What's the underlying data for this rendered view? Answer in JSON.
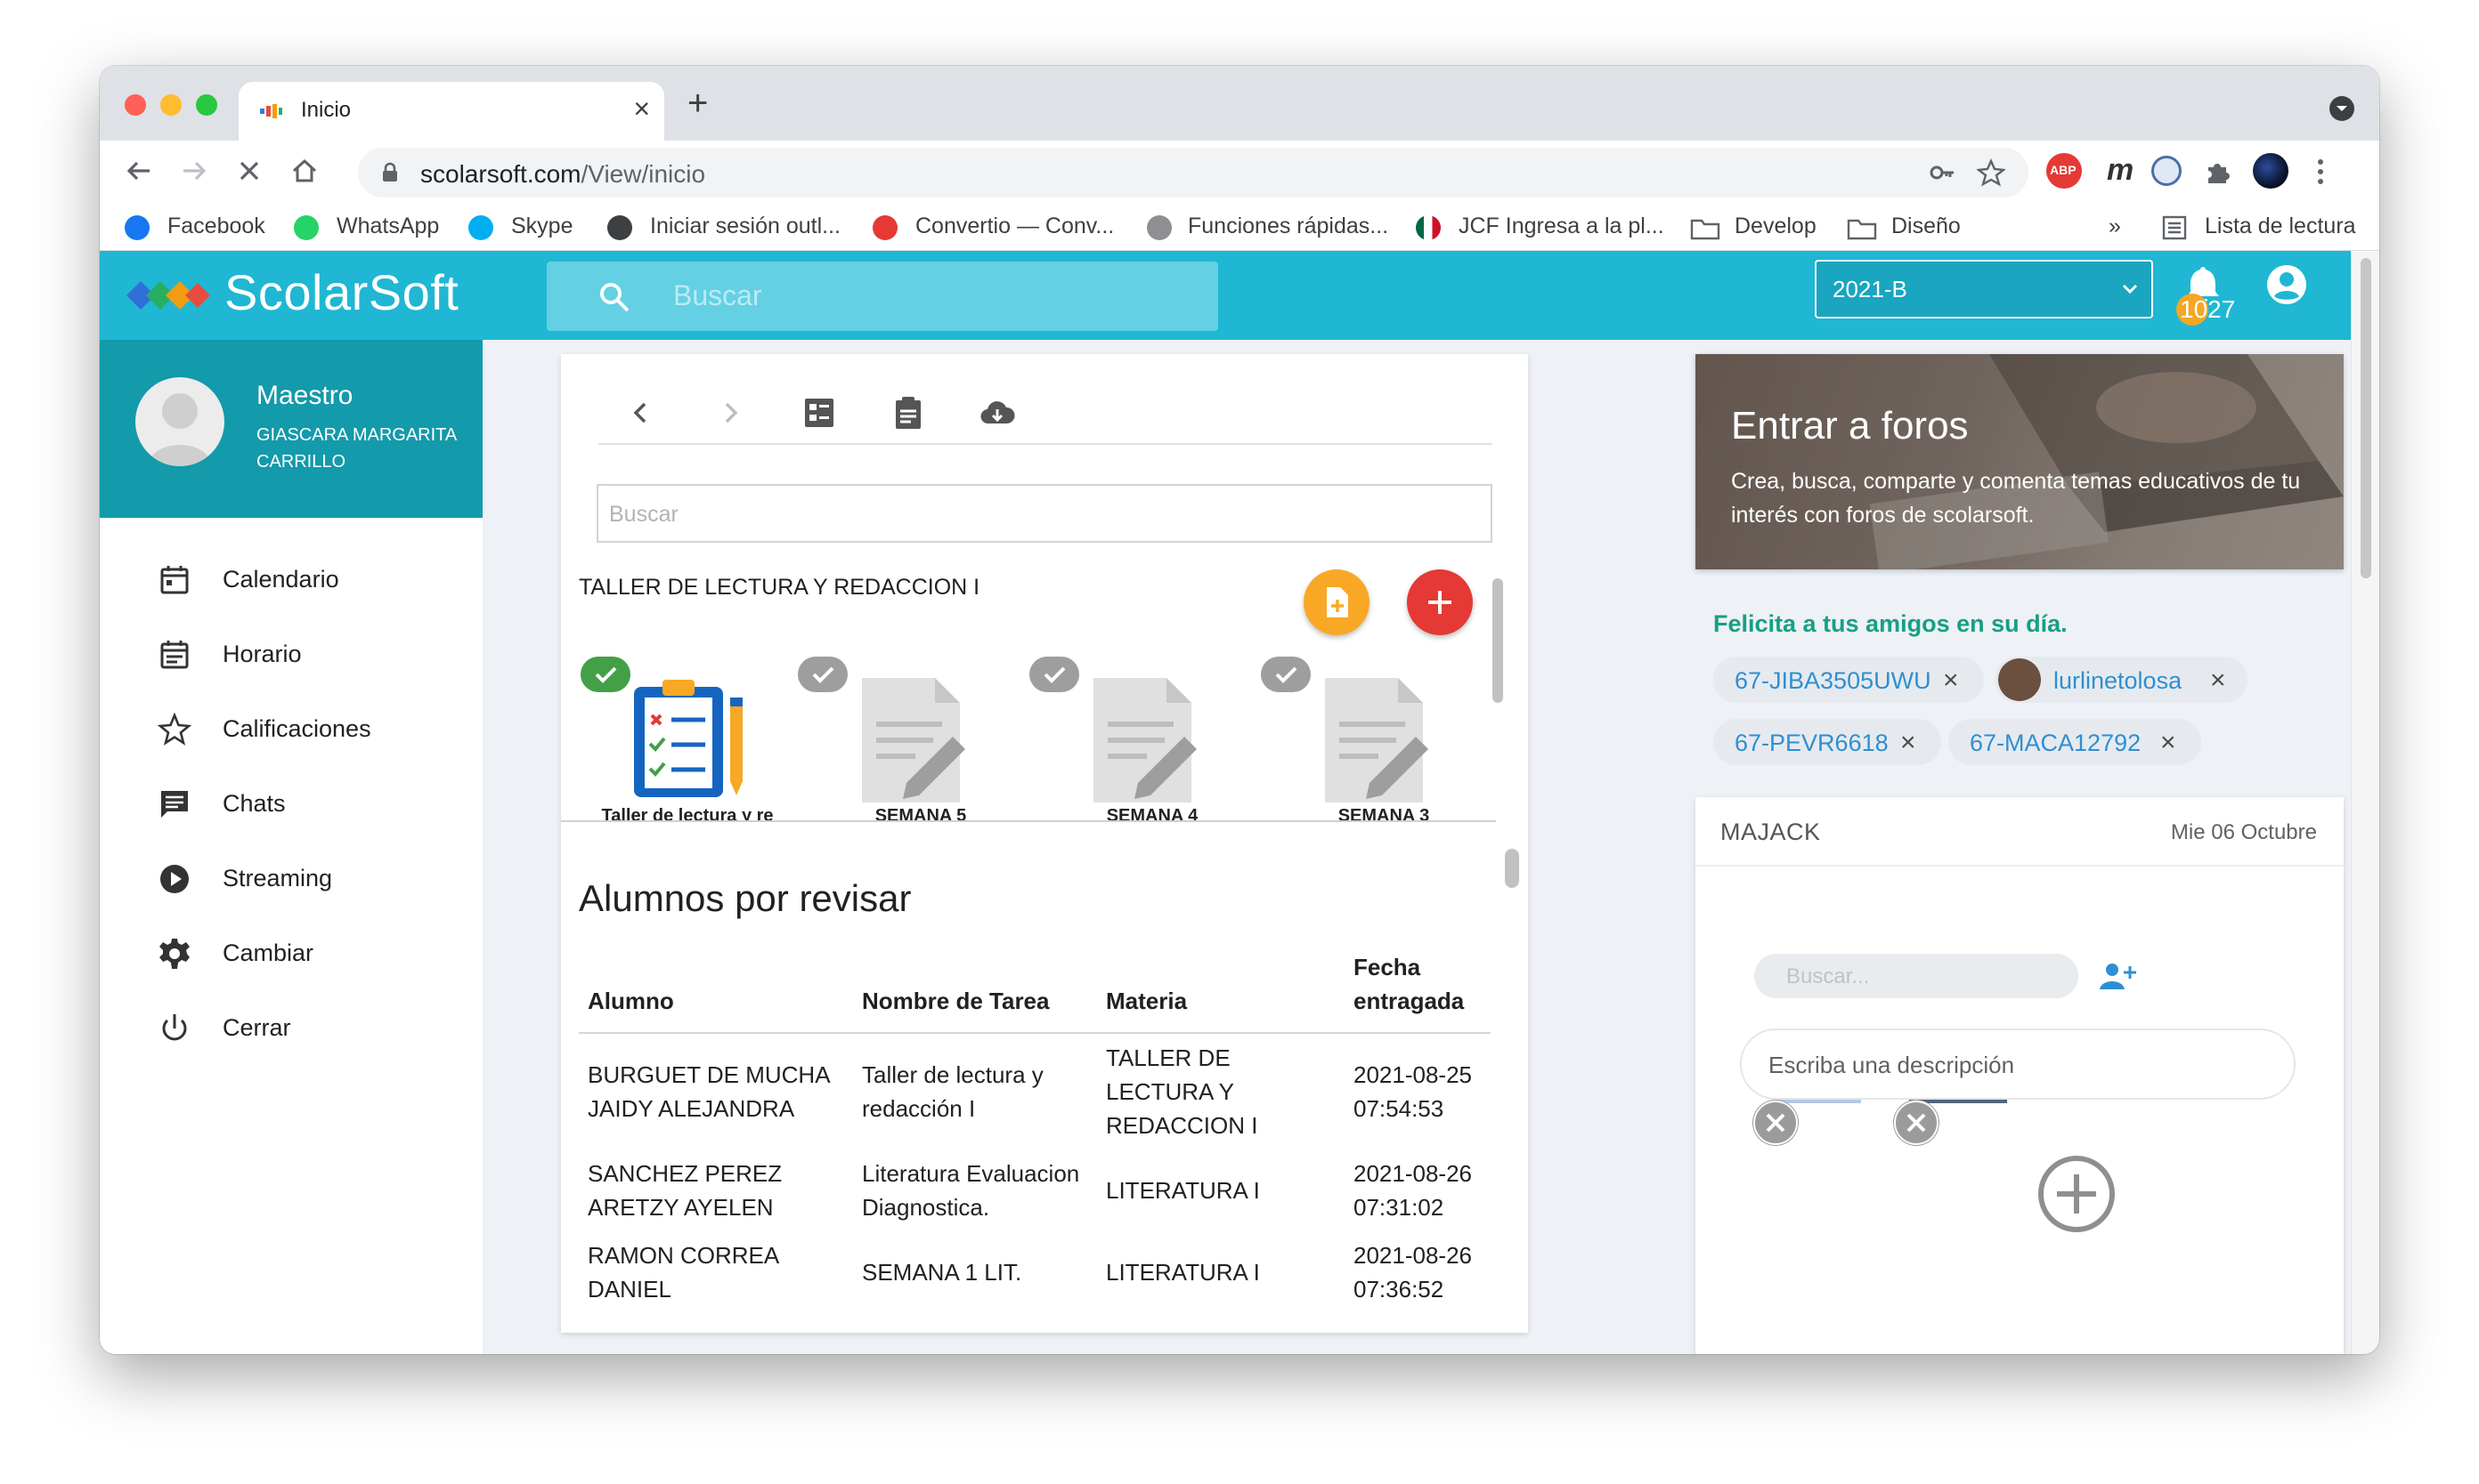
{
  "browser": {
    "tab_title": "Inicio",
    "url_host": "scolarsoft.com",
    "url_path": "/View/inicio",
    "ext_abp": "ABP",
    "ext_m": "m",
    "bookmarks": [
      {
        "label": "Facebook"
      },
      {
        "label": "WhatsApp"
      },
      {
        "label": "Skype"
      },
      {
        "label": "Iniciar sesión outl..."
      },
      {
        "label": "Convertio — Conv..."
      },
      {
        "label": "Funciones rápidas..."
      },
      {
        "label": "JCF Ingresa a la pl..."
      },
      {
        "label": "Develop"
      },
      {
        "label": "Diseño"
      }
    ],
    "overflow": "»",
    "reading_list": "Lista de lectura"
  },
  "header": {
    "logo": "ScolarSoft",
    "search_placeholder": "Buscar",
    "period": "2021-B",
    "notifications": "1027",
    "colors": {
      "primary": "#1fb7d3",
      "sidebar_profile": "#139aab"
    }
  },
  "sidebar": {
    "role": "Maestro",
    "name": "GIASCARA MARGARITA CARRILLO",
    "items": [
      {
        "label": "Calendario",
        "icon": "calendar-icon"
      },
      {
        "label": "Horario",
        "icon": "schedule-icon"
      },
      {
        "label": "Calificaciones",
        "icon": "star-icon"
      },
      {
        "label": "Chats",
        "icon": "chat-icon"
      },
      {
        "label": "Streaming",
        "icon": "play-icon"
      },
      {
        "label": "Cambiar",
        "icon": "gear-icon"
      },
      {
        "label": "Cerrar",
        "icon": "power-icon"
      }
    ]
  },
  "main": {
    "search_placeholder": "Buscar",
    "course": "TALLER DE LECTURA Y REDACCION I",
    "assignments": [
      {
        "label": "Taller de lectura y re"
      },
      {
        "label": "SEMANA 5"
      },
      {
        "label": "SEMANA 4"
      },
      {
        "label": "SEMANA 3"
      }
    ],
    "review_title": "Alumnos por revisar",
    "table": {
      "headers": [
        "Alumno",
        "Nombre de Tarea",
        "Materia",
        "Fecha entragada"
      ],
      "rows": [
        [
          "BURGUET DE MUCHA JAIDY ALEJANDRA",
          "Taller de lectura y redacción I",
          "TALLER DE LECTURA Y REDACCION I",
          "2021-08-25 07:54:53"
        ],
        [
          "SANCHEZ PEREZ ARETZY AYELEN",
          "Literatura Evaluacion Diagnostica.",
          "LITERATURA I",
          "2021-08-26 07:31:02"
        ],
        [
          "RAMON CORREA DANIEL",
          "SEMANA 1 LIT.",
          "LITERATURA I",
          "2021-08-26 07:36:52"
        ]
      ]
    }
  },
  "right": {
    "forum_title": "Entrar a foros",
    "forum_desc": "Crea, busca, comparte y comenta temas educativos de tu interés con foros de scolarsoft.",
    "congrats": "Felicita a tus amigos en su día.",
    "chips": [
      "67-JIBA3505UWU",
      "lurlinetolosa",
      "67-PEVR6618",
      "67-MACA12792"
    ],
    "chip_close": "×",
    "chat": {
      "name": "MAJACK",
      "date": "Mie 06 Octubre",
      "search_placeholder": "Buscar...",
      "desc_placeholder": "Escriba una descripción"
    }
  }
}
